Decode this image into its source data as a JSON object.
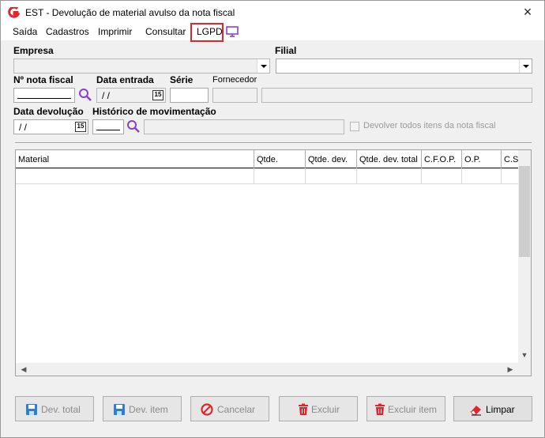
{
  "window": {
    "title": "EST - Devolução de material avulso da nota fiscal"
  },
  "menu": {
    "items": [
      "Saída",
      "Cadastros",
      "Imprimir",
      "Consultar",
      "LGPD"
    ]
  },
  "form": {
    "empresa_label": "Empresa",
    "filial_label": "Filial",
    "nota_label": "Nº nota fiscal",
    "data_entrada_label": "Data entrada",
    "data_entrada_value": " / /",
    "serie_label": "Série",
    "fornecedor_label": "Fornecedor",
    "data_devolucao_label": "Data devolução",
    "data_devolucao_value": " / /",
    "historico_label": "Histórico de movimentação",
    "devolver_todos_label": "Devolver todos itens da nota fiscal",
    "calendar_glyph": "15"
  },
  "grid": {
    "columns": [
      "Material",
      "Qtde.",
      "Qtde. dev.",
      "Qtde. dev. total",
      "C.F.O.P.",
      "O.P.",
      "C.S"
    ]
  },
  "buttons": {
    "dev_total": "Dev. total",
    "dev_item": "Dev. item",
    "cancelar": "Cancelar",
    "excluir": "Excluir",
    "excluir_item": "Excluir item",
    "limpar": "Limpar"
  },
  "colors": {
    "accent_red": "#e0262a",
    "save_blue": "#2d7fd3",
    "magnifier_purple": "#8a3fd1"
  }
}
